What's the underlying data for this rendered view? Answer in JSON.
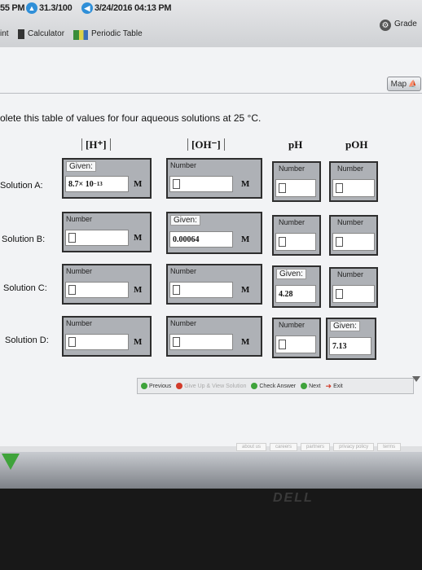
{
  "topbar": {
    "time": "55 PM",
    "score": "31.3/100",
    "datetime": "3/24/2016 04:13 PM",
    "grade": "Grade",
    "left_cut": "int",
    "calculator": "Calculator",
    "periodic_table": "Periodic Table"
  },
  "map_label": "Map",
  "question": "olete this table of values for four aqueous solutions at 25 °C.",
  "columns": {
    "h": "[H⁺]",
    "oh": "[OH⁻]",
    "ph": "pH",
    "poh": "pOH"
  },
  "tags": {
    "number": "Number",
    "given": "Given:"
  },
  "unit": "M",
  "rows": {
    "a": {
      "label": "Solution A:",
      "given_h_mantissa": "8.7× 10",
      "given_h_exp": "−13"
    },
    "b": {
      "label": "Solution B:",
      "given_oh": "0.00064"
    },
    "c": {
      "label": "Solution C:",
      "given_ph": "4.28"
    },
    "d": {
      "label": "Solution D:",
      "given_poh": "7.13"
    }
  },
  "nav": {
    "previous": "Previous",
    "give_up": "Give Up & View Solution",
    "check": "Check Answer",
    "next": "Next",
    "exit": "Exit"
  },
  "footer": [
    "about us",
    "careers",
    "partners",
    "privacy policy",
    "terms"
  ],
  "bezel_logo": "DELL",
  "colors": {
    "green": "#3fa33b",
    "red": "#d23b2a",
    "grey_cell": "#aeb1b6"
  }
}
